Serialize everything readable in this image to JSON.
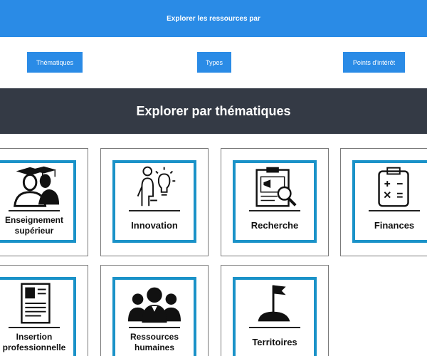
{
  "banner": {
    "title": "Explorer les ressources par"
  },
  "filters": {
    "thematiques": "Thématiques",
    "types": "Types",
    "points_interet": "Points d'intérêt"
  },
  "section": {
    "title": "Explorer par thématiques"
  },
  "cards": [
    {
      "label": "Enseignement supérieur",
      "icon": "graduates-icon"
    },
    {
      "label": "Innovation",
      "icon": "idea-person-icon"
    },
    {
      "label": "Recherche",
      "icon": "research-clipboard-icon"
    },
    {
      "label": "Finances",
      "icon": "calculator-clipboard-icon"
    },
    {
      "label": "Insertion professionnelle",
      "icon": "resume-icon"
    },
    {
      "label": "Ressources humaines",
      "icon": "people-group-icon"
    },
    {
      "label": "Territoires",
      "icon": "flag-hill-icon"
    }
  ],
  "colors": {
    "accent": "#2a8be6",
    "card_border": "#1a92c8",
    "header_bg": "#343a45"
  }
}
